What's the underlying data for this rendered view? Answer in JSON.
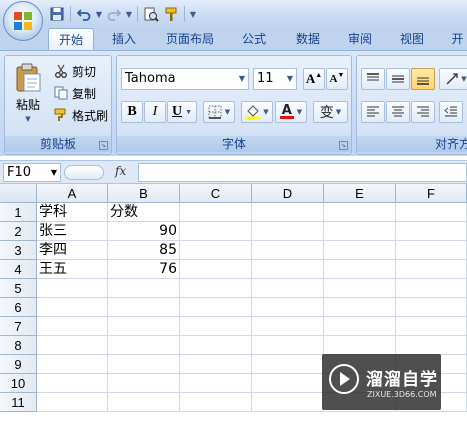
{
  "ribbon_tabs": [
    "开始",
    "插入",
    "页面布局",
    "公式",
    "数据",
    "审阅",
    "视图",
    "开"
  ],
  "active_tab": "开始",
  "clipboard": {
    "paste_label": "粘贴",
    "cut_label": "剪切",
    "copy_label": "复制",
    "format_painter_label": "格式刷",
    "group_label": "剪贴板"
  },
  "font": {
    "family": "Tahoma",
    "size": "11",
    "bold_label": "B",
    "italic_label": "I",
    "underline_label": "U",
    "grow_label": "A",
    "shrink_label": "A",
    "font_color_label": "A",
    "phonetic_label": "变",
    "group_label": "字体"
  },
  "alignment": {
    "group_label": "对齐方"
  },
  "formula_bar": {
    "name_box": "F10",
    "fx_label": "fx",
    "formula": ""
  },
  "sheet": {
    "columns": [
      "A",
      "B",
      "C",
      "D",
      "E",
      "F"
    ],
    "row_numbers": [
      "1",
      "2",
      "3",
      "4",
      "5",
      "6",
      "7",
      "8",
      "9",
      "10",
      "11"
    ],
    "cells": {
      "A1": "学科",
      "B1": "分数",
      "A2": "张三",
      "B2": "90",
      "A3": "李四",
      "B3": "85",
      "A4": "王五",
      "B4": "76"
    }
  },
  "watermark": {
    "title": "溜溜自学",
    "subtitle": "ZIXUE.3D66.COM"
  },
  "colors": {
    "ribbon_bg": "#c7d9f1",
    "tab_text": "#15428b",
    "active_align": "#ffd66b",
    "font_color_swatch": "#e01010",
    "fill_color_swatch": "#ffff00"
  }
}
